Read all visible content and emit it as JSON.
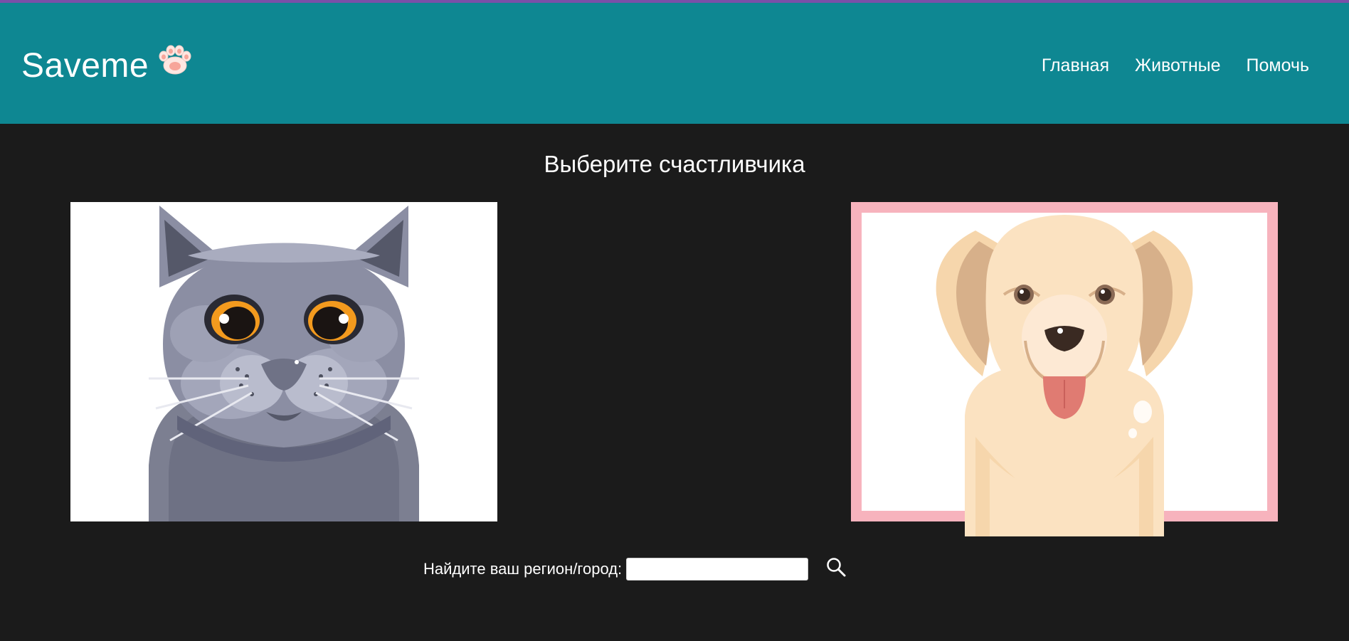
{
  "brand": {
    "name": "Saveme",
    "logo_icon": "paw-icon"
  },
  "nav": {
    "items": [
      {
        "label": "Главная"
      },
      {
        "label": "Животные"
      },
      {
        "label": "Помочь"
      }
    ]
  },
  "main": {
    "title": "Выберите счастливчика",
    "cards": [
      {
        "animal_icon": "cat-icon",
        "selected": false
      },
      {
        "animal_icon": "dog-icon",
        "selected": true
      }
    ]
  },
  "search": {
    "label": "Найдите ваш регион/город:",
    "value": "",
    "placeholder": "",
    "button_icon": "search-icon"
  },
  "colors": {
    "header_bg": "#0e8792",
    "page_bg": "#1b1b1b",
    "selected_border": "#f7b3bd",
    "top_strip": "#7a4fa8"
  }
}
